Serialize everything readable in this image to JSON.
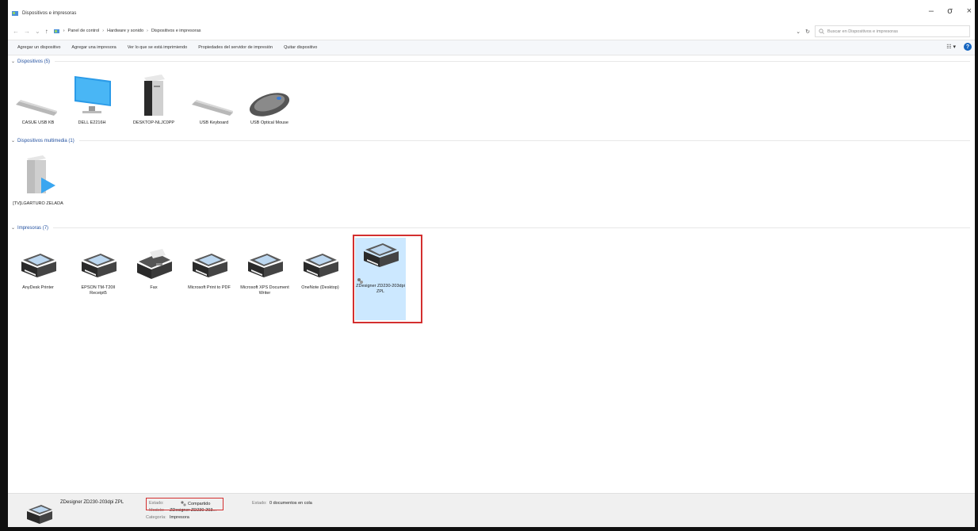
{
  "window": {
    "title": "Dispositivos e impresoras",
    "min": "–",
    "max": "σ",
    "close": "×"
  },
  "address": {
    "back": "←",
    "forward": "→",
    "recent": "⌄",
    "up": "↑",
    "crumbs": [
      "Panel de control",
      "Hardware y sonido",
      "Dispositivos e impresoras"
    ],
    "sep": "›",
    "dropdown": "⌄",
    "refresh": "↻",
    "search_placeholder": "Buscar en Dispositivos e impresoras"
  },
  "toolbar": {
    "items": [
      "Agregar un dispositivo",
      "Agregar una impresora",
      "Ver lo que se está imprimiendo",
      "Propiedades del servidor de impresión",
      "Quitar dispositivo"
    ],
    "view": "☷ ▾",
    "help": "?"
  },
  "sections": {
    "devices": {
      "chev": "⌄",
      "title": "Dispositivos (5)"
    },
    "multimedia": {
      "chev": "⌄",
      "title": "Dispositivos multimedia (1)"
    },
    "printers": {
      "chev": "⌄",
      "title": "Impresoras (7)"
    }
  },
  "devices": [
    "CASUE USB KB",
    "DELL E2216H",
    "DESKTOP-NLJC0PP",
    "USB Keyboard",
    "USB Optical Mouse"
  ],
  "multimedia": [
    "[TV]LGARTURO ZELADA"
  ],
  "printers": [
    "AnyDesk Printer",
    "EPSON TM-T20II Receipt5",
    "Fax",
    "Microsoft Print to PDF",
    "Microsoft XPS Document Writer",
    "OneNote (Desktop)",
    "ZDesigner ZD230-203dpi ZPL"
  ],
  "details": {
    "name": "ZDesigner ZD230-203dpi ZPL",
    "estado_label": "Estado:",
    "estado_value": "Compartido",
    "model_label": "Modelo:",
    "model_value": "ZDesigner ZD230-203...",
    "category_label": "Categoría:",
    "category_value": "Impresora",
    "queue_label": "Estado:",
    "queue_value": "0 documentos en cola"
  },
  "colors": {
    "accent": "#1f4e9e",
    "selection": "#cce8ff",
    "highlight": "#d32f2f"
  }
}
